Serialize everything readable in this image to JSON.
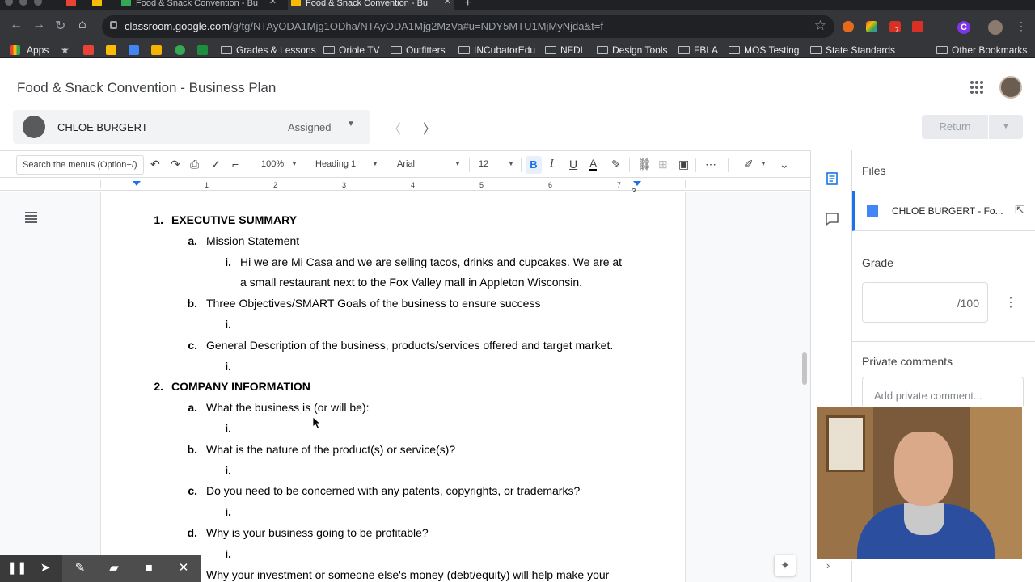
{
  "browser": {
    "tabs": [
      {
        "title": "Food & Snack Convention - Bu"
      },
      {
        "title": "Food & Snack Convention - Bu"
      }
    ],
    "url_host": "classroom.google.com",
    "url_path": "/g/tg/NTAyODA1Mjg1ODha/NTAyODA1Mjg2MzVa#u=NDY5MTU1MjMyNjda&t=f",
    "ext_badge": "7",
    "profile_letter": "C",
    "bookmarks": [
      {
        "label": "Apps"
      },
      {
        "label": "Grades & Lessons"
      },
      {
        "label": "Oriole TV"
      },
      {
        "label": "Outfitters"
      },
      {
        "label": "INCubatorEdu"
      },
      {
        "label": "NFDL"
      },
      {
        "label": "Design Tools"
      },
      {
        "label": "FBLA"
      },
      {
        "label": "MOS Testing"
      },
      {
        "label": "State Standards"
      },
      {
        "label": "Other Bookmarks"
      }
    ]
  },
  "classroom": {
    "title": "Food & Snack Convention - Business Plan",
    "student_name": "CHLOE BURGERT",
    "student_status": "Assigned",
    "return_label": "Return"
  },
  "docs_toolbar": {
    "search_placeholder": "Search the menus (Option+/)",
    "zoom": "100%",
    "style": "Heading 1",
    "font": "Arial",
    "font_size": "12",
    "bold": "B",
    "italic": "I",
    "underline": "U",
    "text_color": "A"
  },
  "ruler": {
    "numbers": [
      "1",
      "1",
      "2",
      "3",
      "4",
      "5",
      "6",
      "7"
    ],
    "page_marker": "3"
  },
  "document": {
    "lines": [
      {
        "marker": "1.",
        "text": "EXECUTIVE SUMMARY"
      },
      {
        "marker": "a.",
        "text": "Mission Statement"
      },
      {
        "marker": "i.",
        "text": "Hi we are Mi Casa and we are selling tacos, drinks and cupcakes. We are at"
      },
      {
        "marker": "",
        "text": "a small restaurant next to the Fox Valley mall in Appleton Wisconsin."
      },
      {
        "marker": "b.",
        "text": "Three Objectives/SMART Goals of the business to ensure success"
      },
      {
        "marker": "i.",
        "text": ""
      },
      {
        "marker": "c.",
        "text": "General Description of the business, products/services offered and target market."
      },
      {
        "marker": "i.",
        "text": ""
      },
      {
        "marker": "2.",
        "text": "COMPANY INFORMATION"
      },
      {
        "marker": "a.",
        "text": "What the business is (or will be):"
      },
      {
        "marker": "i.",
        "text": ""
      },
      {
        "marker": "b.",
        "text": "What is the nature of the product(s) or service(s)?"
      },
      {
        "marker": "i.",
        "text": ""
      },
      {
        "marker": "c.",
        "text": "Do you need to be concerned with any patents, copyrights, or trademarks?"
      },
      {
        "marker": "i.",
        "text": ""
      },
      {
        "marker": "d.",
        "text": "Why is your business going to be profitable?"
      },
      {
        "marker": "i.",
        "text": ""
      },
      {
        "marker": "",
        "text": "Why your investment or someone else's money (debt/equity) will help make your"
      }
    ]
  },
  "side_panel": {
    "files_title": "Files",
    "file_name": "CHLOE BURGERT - Fo...",
    "grade_title": "Grade",
    "grade_out_of": "/100",
    "private_comments_title": "Private comments",
    "private_comment_placeholder": "Add private comment..."
  },
  "colors": {
    "accent": "#1a73e8",
    "chrome_dark": "#35363a",
    "doc_blue": "#4285f4"
  }
}
